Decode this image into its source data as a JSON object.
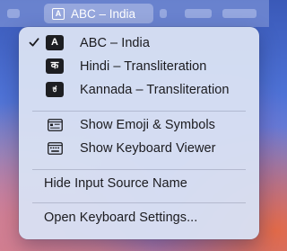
{
  "menubar": {
    "input_badge": "A",
    "input_label": "ABC – India"
  },
  "menu": {
    "sources": [
      {
        "badge": "A",
        "label": "ABC – India",
        "checked": true
      },
      {
        "badge": "क",
        "label": "Hindi – Transliteration",
        "checked": false
      },
      {
        "badge": "ಕ",
        "label": "Kannada – Transliteration",
        "checked": false
      }
    ],
    "tools": [
      {
        "icon": "emoji-symbols-icon",
        "label": "Show Emoji & Symbols"
      },
      {
        "icon": "keyboard-viewer-icon",
        "label": "Show Keyboard Viewer"
      }
    ],
    "hide_label": "Hide Input Source Name",
    "settings_label": "Open Keyboard Settings..."
  }
}
